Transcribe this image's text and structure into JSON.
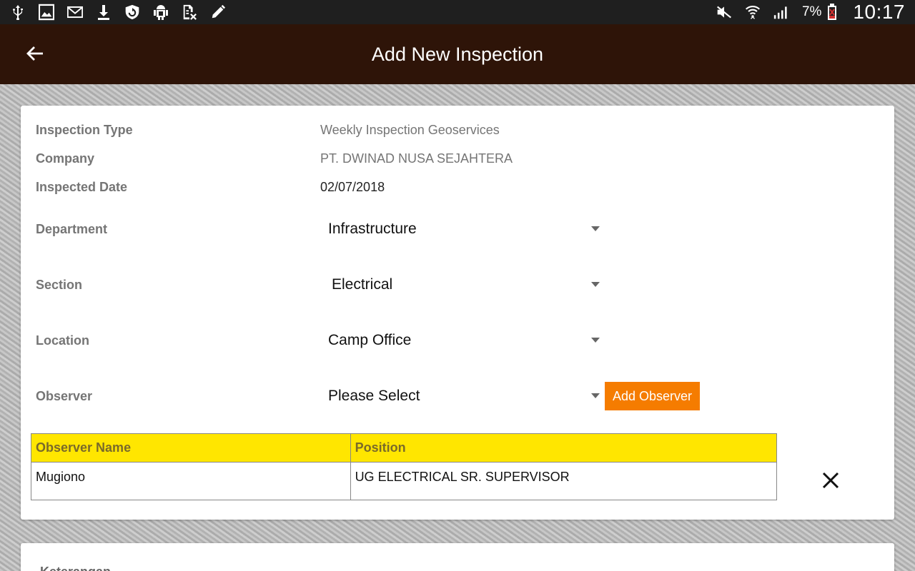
{
  "status_bar": {
    "left_icons": [
      "usb-icon",
      "image-icon",
      "mail-icon",
      "download-icon",
      "shield-icon",
      "android-debug-icon",
      "no-sim-doc-icon",
      "pencil-icon"
    ],
    "right_icons": [
      "mute-icon",
      "wifi-icon",
      "signal-icon",
      "battery-low-icon"
    ],
    "battery_percent": "7%",
    "time": "10:17"
  },
  "app_bar": {
    "title": "Add New Inspection",
    "back_icon": "arrow-back-icon",
    "color": "#2e1408"
  },
  "form": {
    "inspection_type": {
      "label": "Inspection Type",
      "value": "Weekly Inspection Geoservices"
    },
    "company": {
      "label": "Company",
      "value": "PT. DWINAD NUSA SEJAHTERA"
    },
    "inspected_date": {
      "label": "Inspected Date",
      "value": "02/07/2018"
    },
    "department": {
      "label": "Department",
      "selected": "Infrastructure"
    },
    "section": {
      "label": "Section",
      "selected": "Electrical"
    },
    "location": {
      "label": "Location",
      "selected": "Camp Office"
    },
    "observer": {
      "label": "Observer",
      "selected": "Please Select"
    },
    "add_observer_label": "Add Observer",
    "accent_color": "#f57c00"
  },
  "observer_table": {
    "headers": [
      "Observer Name",
      "Position"
    ],
    "header_color": "#ffe600",
    "rows": [
      {
        "name": "Mugiono",
        "position": "UG ELECTRICAL SR. SUPERVISOR"
      }
    ],
    "remove_icon": "close-icon"
  },
  "second_card": {
    "label": "Keterangan"
  }
}
